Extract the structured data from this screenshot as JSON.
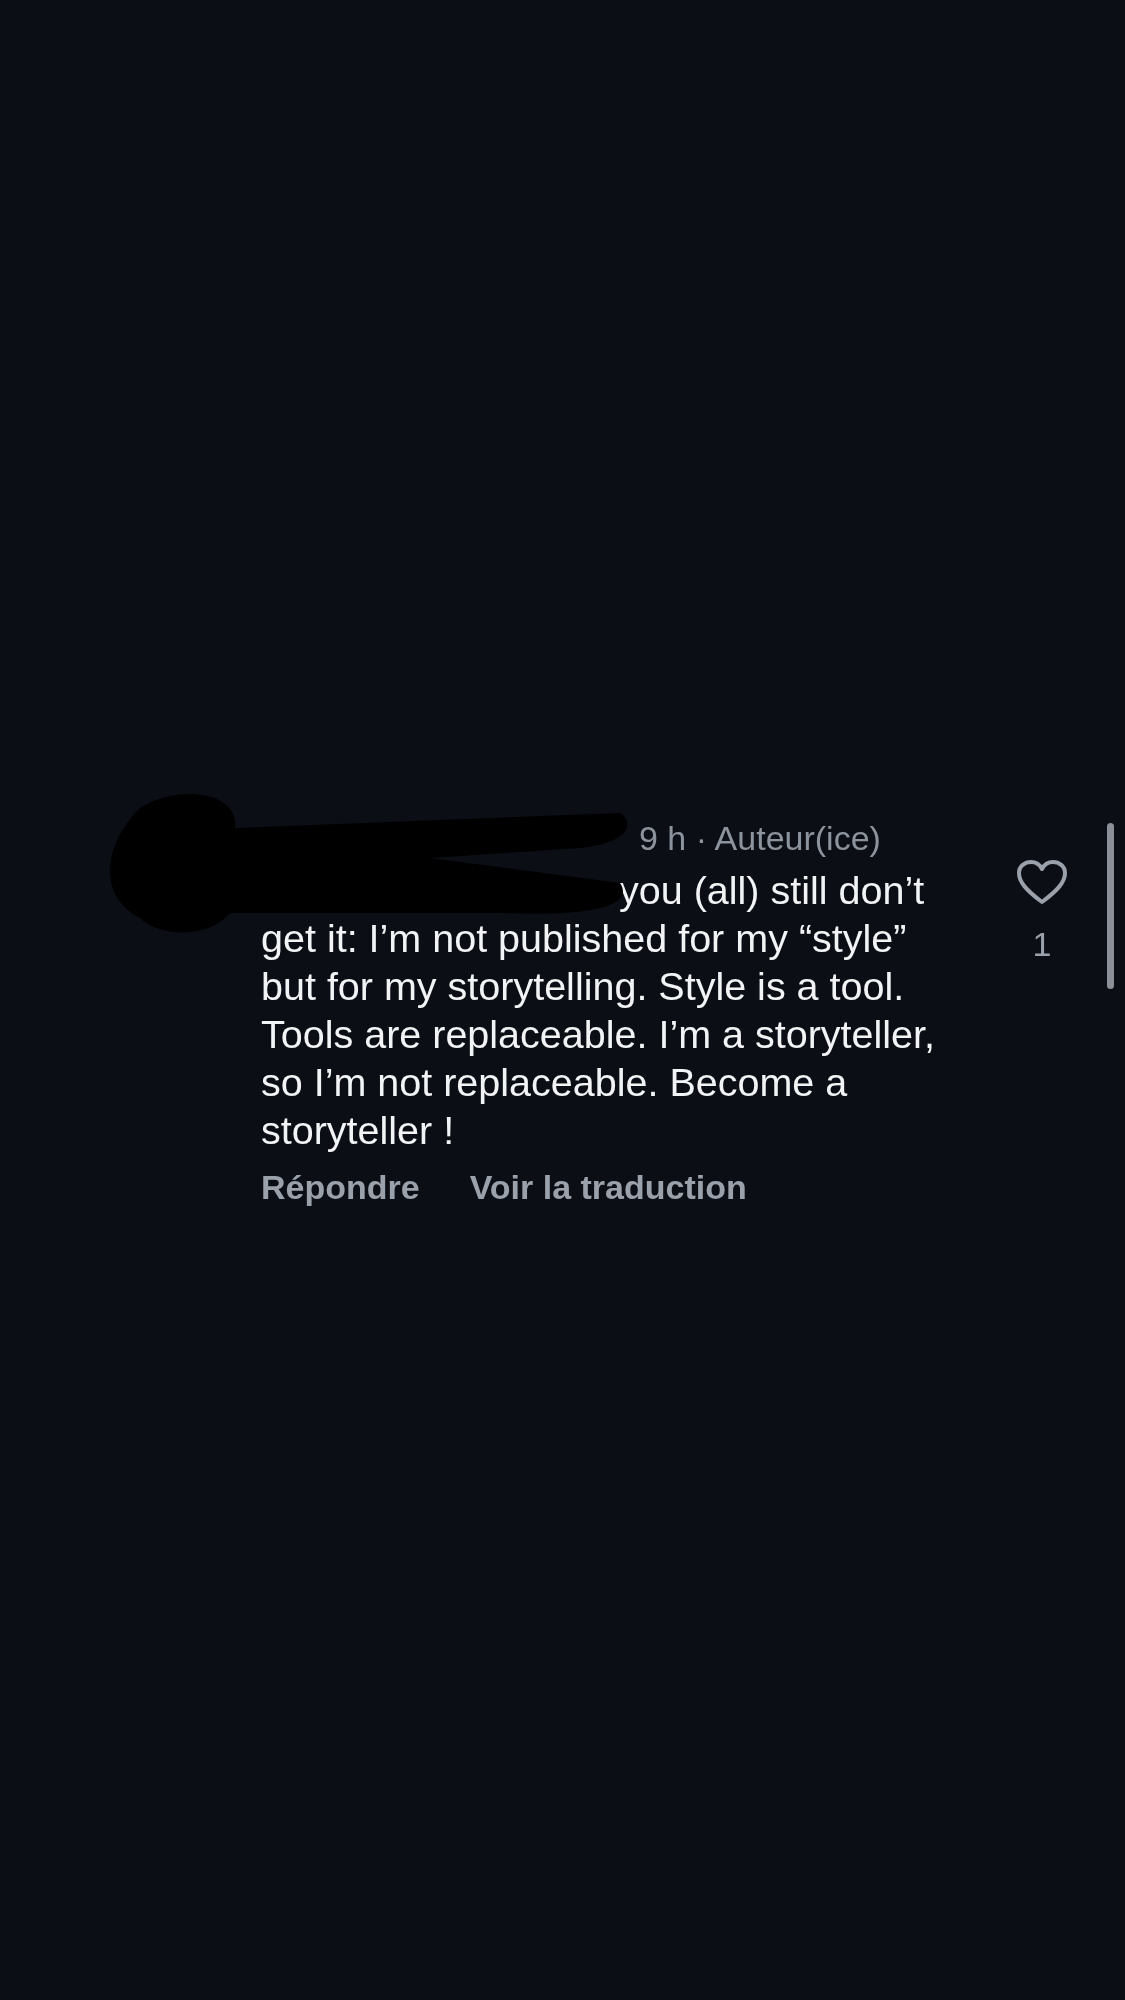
{
  "comment": {
    "meta": "9 h · Auteur(ice)",
    "text": "you (all) still don’t get it: I’m not published for my “style” but for my storytelling. Style is a tool. Tools are replaceable. I’m a storyteller, so I’m not replaceable. Become a storyteller !",
    "like_count": "1",
    "liked": false,
    "actions": [
      "Répondre",
      "Voir la traduction"
    ]
  }
}
